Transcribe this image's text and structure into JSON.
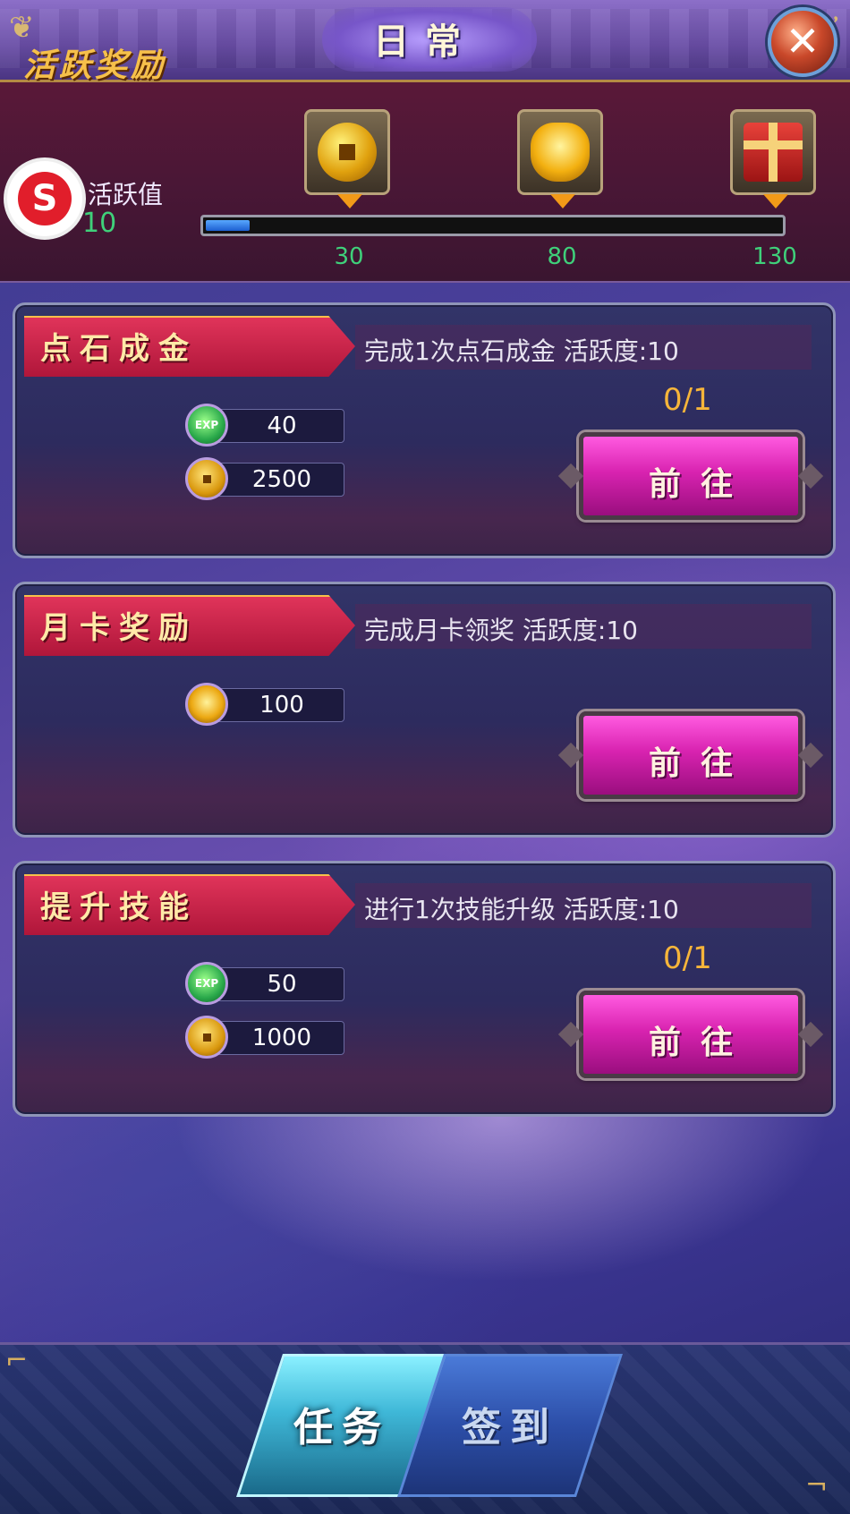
{
  "header": {
    "title": "日常",
    "close_glyph": "✕"
  },
  "activity": {
    "title": "活跃奖励",
    "label": "活跃值",
    "value": "10",
    "current": 10,
    "max": 130,
    "rewards": [
      {
        "icon": "coin-icon",
        "milestone": "30"
      },
      {
        "icon": "gold-ingot-icon",
        "milestone": "80"
      },
      {
        "icon": "gift-box-icon",
        "milestone": "130"
      }
    ]
  },
  "tasks": [
    {
      "name": "点石成金",
      "description": "完成1次点石成金  活跃度:10",
      "progress": "0/1",
      "rewards": [
        {
          "icon": "exp-icon",
          "value": "40"
        },
        {
          "icon": "coin-icon",
          "value": "2500"
        }
      ],
      "button": "前往"
    },
    {
      "name": "月卡奖励",
      "description": "完成月卡领奖  活跃度:10",
      "progress": "",
      "rewards": [
        {
          "icon": "gold-ingot-icon",
          "value": "100"
        }
      ],
      "button": "前往"
    },
    {
      "name": "提升技能",
      "description": "进行1次技能升级  活跃度:10",
      "progress": "0/1",
      "rewards": [
        {
          "icon": "exp-icon",
          "value": "50"
        },
        {
          "icon": "coin-icon",
          "value": "1000"
        }
      ],
      "button": "前往"
    }
  ],
  "tabs": {
    "active": "任务",
    "inactive": "签到"
  },
  "colors": {
    "accent_gold": "#f6c04a",
    "progress_green": "#3fd07a",
    "go_button": "#d823b0"
  }
}
